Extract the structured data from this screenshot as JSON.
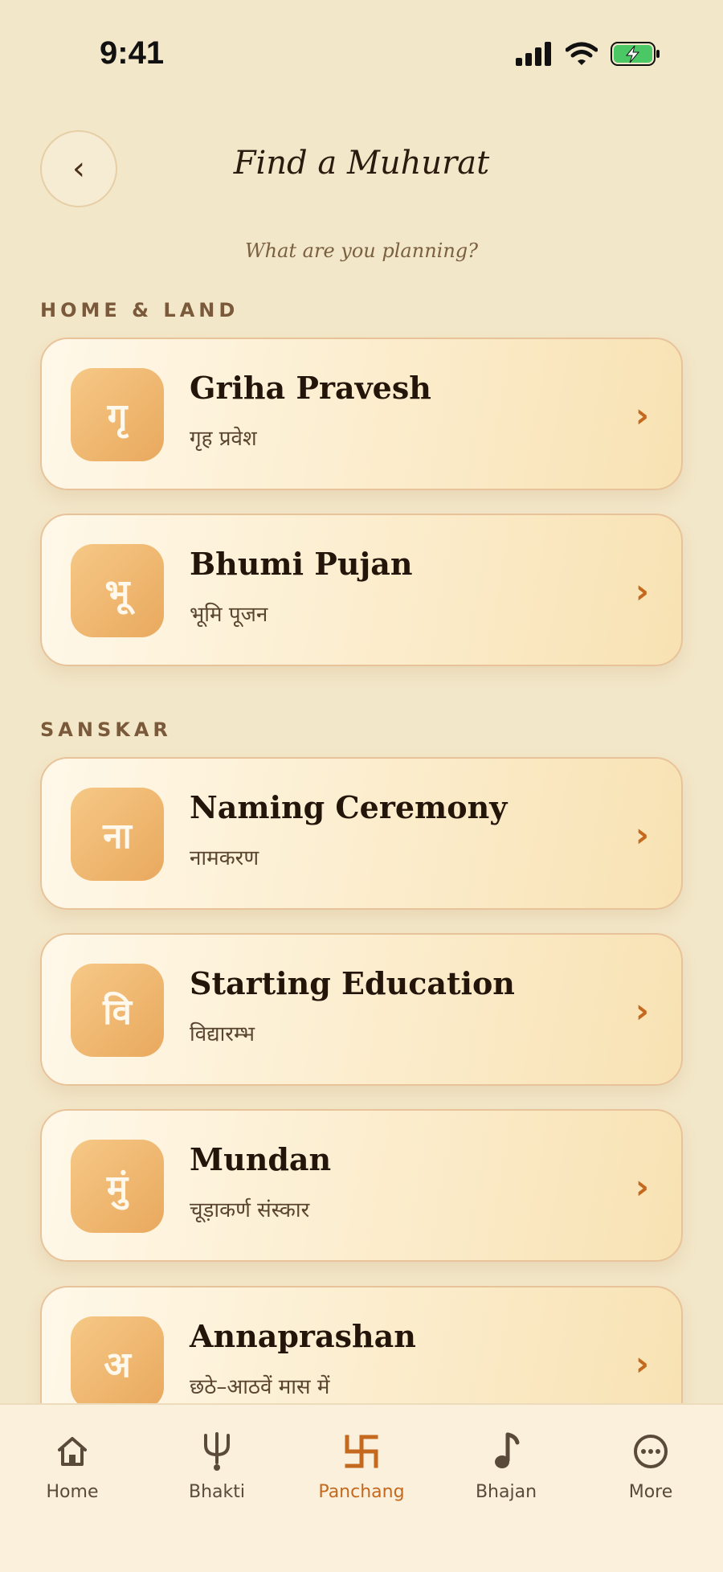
{
  "status_bar": {
    "time": "9:41"
  },
  "header": {
    "title": "Find a Muhurat",
    "back_glyph": "‹",
    "subtitle": "What are you planning?"
  },
  "sections": [
    {
      "label": "HOME & LAND",
      "cards": [
        {
          "glyph": "गृ",
          "title": "Griha Pravesh",
          "subtitle": "गृह प्रवेश"
        },
        {
          "glyph": "भू",
          "title": "Bhumi Pujan",
          "subtitle": "भूमि पूजन"
        }
      ]
    },
    {
      "label": "SANSKAR",
      "cards": [
        {
          "glyph": "ना",
          "title": "Naming Ceremony",
          "subtitle": "नामकरण"
        },
        {
          "glyph": "वि",
          "title": "Starting Education",
          "subtitle": "विद्यारम्भ"
        },
        {
          "glyph": "मुं",
          "title": "Mundan",
          "subtitle": "चूड़ाकर्ण संस्कार"
        },
        {
          "glyph": "अ",
          "title": "Annaprashan",
          "subtitle": "छठे–आठवें मास में"
        }
      ]
    }
  ],
  "chevron": "›",
  "nav": {
    "items": [
      {
        "label": "Home",
        "icon": "home-icon"
      },
      {
        "label": "Bhakti",
        "icon": "trident-icon"
      },
      {
        "label": "Panchang",
        "icon": "swastika-icon",
        "active": true
      },
      {
        "label": "Bhajan",
        "icon": "music-note-icon"
      },
      {
        "label": "More",
        "icon": "more-icon"
      }
    ]
  },
  "colors": {
    "accent": "#c4691e",
    "background": "#f3e7c9",
    "icon_tile": "#eeb56e"
  }
}
